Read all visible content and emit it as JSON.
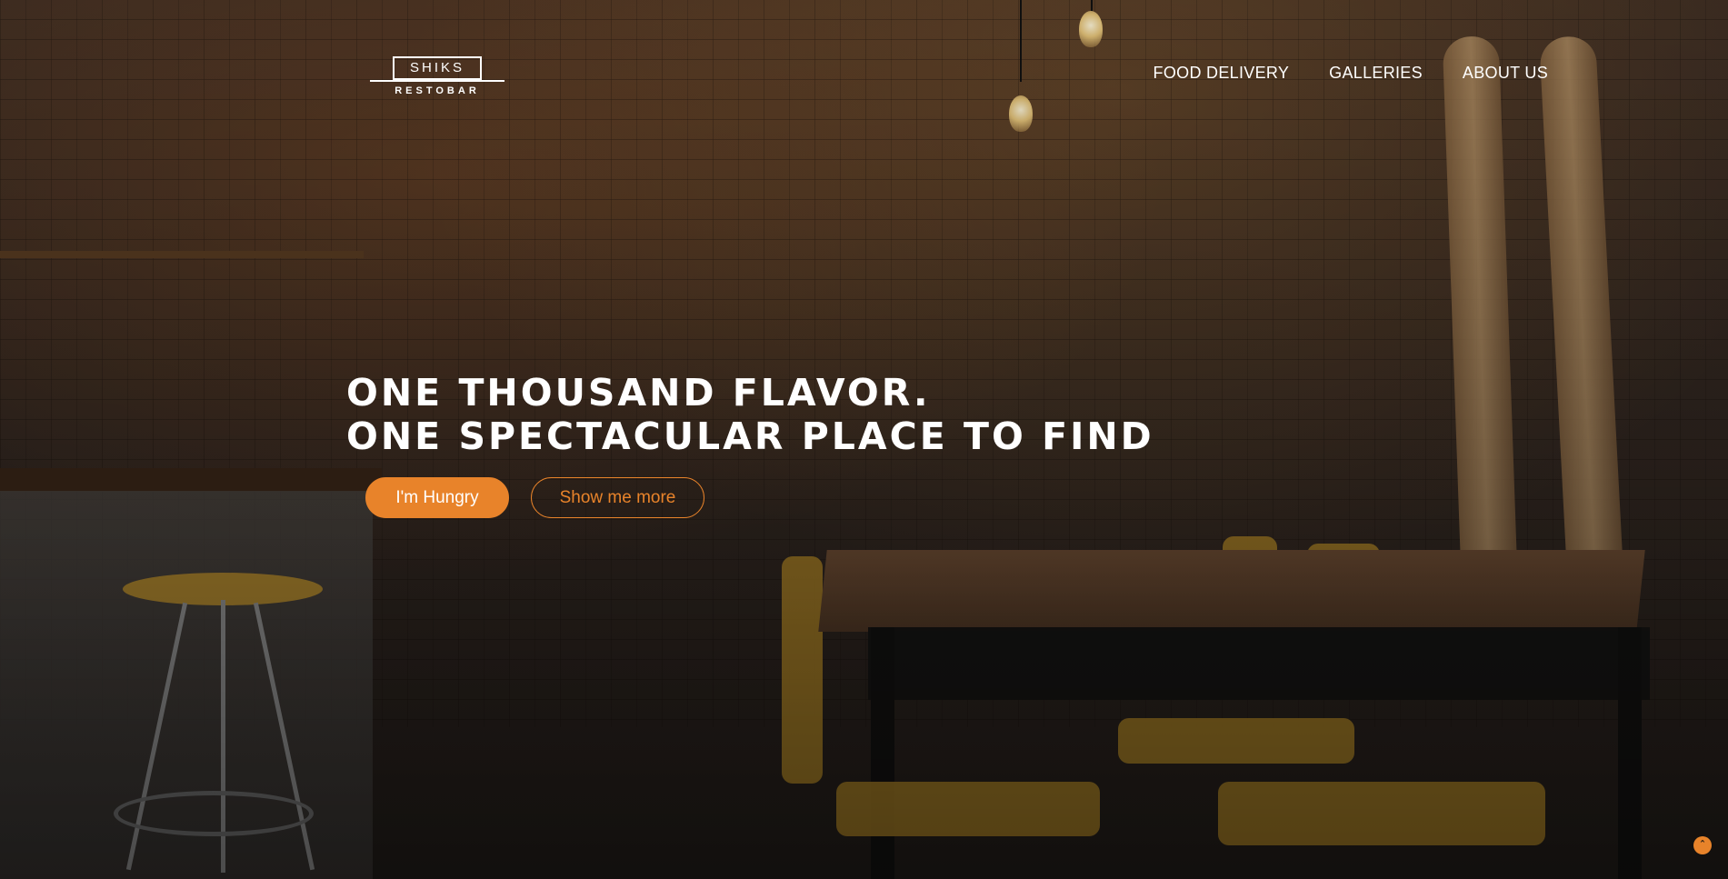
{
  "brand": {
    "name": "SHIKS",
    "tagline": "RESTOBAR"
  },
  "nav": {
    "items": [
      {
        "label": "FOOD DELIVERY"
      },
      {
        "label": "GALLERIES"
      },
      {
        "label": "ABOUT US"
      }
    ]
  },
  "hero": {
    "headline_line1": "ONE THOUSAND FLAVOR.",
    "headline_line2": "ONE SPECTACULAR PLACE TO FIND",
    "primary_button": "I'm Hungry",
    "secondary_button": "Show me more"
  },
  "icons": {
    "scroll_top": "chevron-up-icon"
  },
  "colors": {
    "accent": "#e8832a",
    "text": "#ffffff"
  }
}
